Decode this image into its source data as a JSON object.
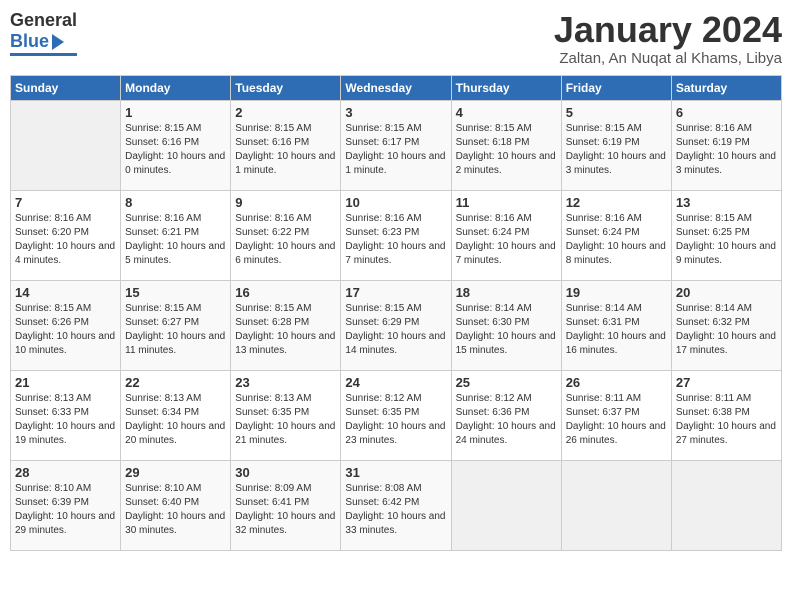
{
  "header": {
    "logo": {
      "general": "General",
      "blue": "Blue"
    },
    "title": "January 2024",
    "location": "Zaltan, An Nuqat al Khams, Libya"
  },
  "calendar": {
    "days_of_week": [
      "Sunday",
      "Monday",
      "Tuesday",
      "Wednesday",
      "Thursday",
      "Friday",
      "Saturday"
    ],
    "weeks": [
      [
        {
          "day": "",
          "sunrise": "",
          "sunset": "",
          "daylight": ""
        },
        {
          "day": "1",
          "sunrise": "Sunrise: 8:15 AM",
          "sunset": "Sunset: 6:16 PM",
          "daylight": "Daylight: 10 hours and 0 minutes."
        },
        {
          "day": "2",
          "sunrise": "Sunrise: 8:15 AM",
          "sunset": "Sunset: 6:16 PM",
          "daylight": "Daylight: 10 hours and 1 minute."
        },
        {
          "day": "3",
          "sunrise": "Sunrise: 8:15 AM",
          "sunset": "Sunset: 6:17 PM",
          "daylight": "Daylight: 10 hours and 1 minute."
        },
        {
          "day": "4",
          "sunrise": "Sunrise: 8:15 AM",
          "sunset": "Sunset: 6:18 PM",
          "daylight": "Daylight: 10 hours and 2 minutes."
        },
        {
          "day": "5",
          "sunrise": "Sunrise: 8:15 AM",
          "sunset": "Sunset: 6:19 PM",
          "daylight": "Daylight: 10 hours and 3 minutes."
        },
        {
          "day": "6",
          "sunrise": "Sunrise: 8:16 AM",
          "sunset": "Sunset: 6:19 PM",
          "daylight": "Daylight: 10 hours and 3 minutes."
        }
      ],
      [
        {
          "day": "7",
          "sunrise": "Sunrise: 8:16 AM",
          "sunset": "Sunset: 6:20 PM",
          "daylight": "Daylight: 10 hours and 4 minutes."
        },
        {
          "day": "8",
          "sunrise": "Sunrise: 8:16 AM",
          "sunset": "Sunset: 6:21 PM",
          "daylight": "Daylight: 10 hours and 5 minutes."
        },
        {
          "day": "9",
          "sunrise": "Sunrise: 8:16 AM",
          "sunset": "Sunset: 6:22 PM",
          "daylight": "Daylight: 10 hours and 6 minutes."
        },
        {
          "day": "10",
          "sunrise": "Sunrise: 8:16 AM",
          "sunset": "Sunset: 6:23 PM",
          "daylight": "Daylight: 10 hours and 7 minutes."
        },
        {
          "day": "11",
          "sunrise": "Sunrise: 8:16 AM",
          "sunset": "Sunset: 6:24 PM",
          "daylight": "Daylight: 10 hours and 7 minutes."
        },
        {
          "day": "12",
          "sunrise": "Sunrise: 8:16 AM",
          "sunset": "Sunset: 6:24 PM",
          "daylight": "Daylight: 10 hours and 8 minutes."
        },
        {
          "day": "13",
          "sunrise": "Sunrise: 8:15 AM",
          "sunset": "Sunset: 6:25 PM",
          "daylight": "Daylight: 10 hours and 9 minutes."
        }
      ],
      [
        {
          "day": "14",
          "sunrise": "Sunrise: 8:15 AM",
          "sunset": "Sunset: 6:26 PM",
          "daylight": "Daylight: 10 hours and 10 minutes."
        },
        {
          "day": "15",
          "sunrise": "Sunrise: 8:15 AM",
          "sunset": "Sunset: 6:27 PM",
          "daylight": "Daylight: 10 hours and 11 minutes."
        },
        {
          "day": "16",
          "sunrise": "Sunrise: 8:15 AM",
          "sunset": "Sunset: 6:28 PM",
          "daylight": "Daylight: 10 hours and 13 minutes."
        },
        {
          "day": "17",
          "sunrise": "Sunrise: 8:15 AM",
          "sunset": "Sunset: 6:29 PM",
          "daylight": "Daylight: 10 hours and 14 minutes."
        },
        {
          "day": "18",
          "sunrise": "Sunrise: 8:14 AM",
          "sunset": "Sunset: 6:30 PM",
          "daylight": "Daylight: 10 hours and 15 minutes."
        },
        {
          "day": "19",
          "sunrise": "Sunrise: 8:14 AM",
          "sunset": "Sunset: 6:31 PM",
          "daylight": "Daylight: 10 hours and 16 minutes."
        },
        {
          "day": "20",
          "sunrise": "Sunrise: 8:14 AM",
          "sunset": "Sunset: 6:32 PM",
          "daylight": "Daylight: 10 hours and 17 minutes."
        }
      ],
      [
        {
          "day": "21",
          "sunrise": "Sunrise: 8:13 AM",
          "sunset": "Sunset: 6:33 PM",
          "daylight": "Daylight: 10 hours and 19 minutes."
        },
        {
          "day": "22",
          "sunrise": "Sunrise: 8:13 AM",
          "sunset": "Sunset: 6:34 PM",
          "daylight": "Daylight: 10 hours and 20 minutes."
        },
        {
          "day": "23",
          "sunrise": "Sunrise: 8:13 AM",
          "sunset": "Sunset: 6:35 PM",
          "daylight": "Daylight: 10 hours and 21 minutes."
        },
        {
          "day": "24",
          "sunrise": "Sunrise: 8:12 AM",
          "sunset": "Sunset: 6:35 PM",
          "daylight": "Daylight: 10 hours and 23 minutes."
        },
        {
          "day": "25",
          "sunrise": "Sunrise: 8:12 AM",
          "sunset": "Sunset: 6:36 PM",
          "daylight": "Daylight: 10 hours and 24 minutes."
        },
        {
          "day": "26",
          "sunrise": "Sunrise: 8:11 AM",
          "sunset": "Sunset: 6:37 PM",
          "daylight": "Daylight: 10 hours and 26 minutes."
        },
        {
          "day": "27",
          "sunrise": "Sunrise: 8:11 AM",
          "sunset": "Sunset: 6:38 PM",
          "daylight": "Daylight: 10 hours and 27 minutes."
        }
      ],
      [
        {
          "day": "28",
          "sunrise": "Sunrise: 8:10 AM",
          "sunset": "Sunset: 6:39 PM",
          "daylight": "Daylight: 10 hours and 29 minutes."
        },
        {
          "day": "29",
          "sunrise": "Sunrise: 8:10 AM",
          "sunset": "Sunset: 6:40 PM",
          "daylight": "Daylight: 10 hours and 30 minutes."
        },
        {
          "day": "30",
          "sunrise": "Sunrise: 8:09 AM",
          "sunset": "Sunset: 6:41 PM",
          "daylight": "Daylight: 10 hours and 32 minutes."
        },
        {
          "day": "31",
          "sunrise": "Sunrise: 8:08 AM",
          "sunset": "Sunset: 6:42 PM",
          "daylight": "Daylight: 10 hours and 33 minutes."
        },
        {
          "day": "",
          "sunrise": "",
          "sunset": "",
          "daylight": ""
        },
        {
          "day": "",
          "sunrise": "",
          "sunset": "",
          "daylight": ""
        },
        {
          "day": "",
          "sunrise": "",
          "sunset": "",
          "daylight": ""
        }
      ]
    ]
  }
}
